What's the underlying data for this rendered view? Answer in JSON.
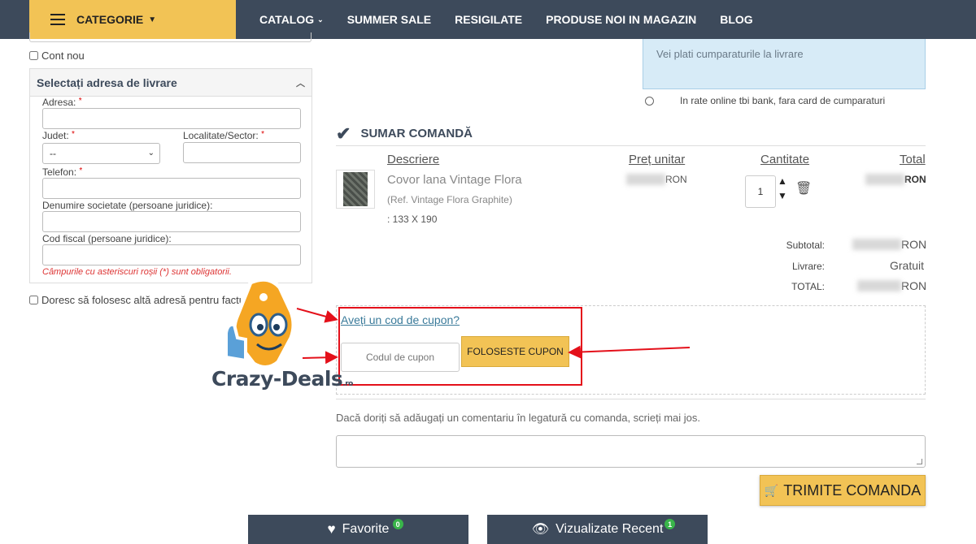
{
  "topnav": {
    "category_label": "CATEGORIE",
    "items": [
      "CATALOG",
      "SUMMER SALE",
      "RESIGILATE",
      "PRODUSE NOI IN MAGAZIN",
      "BLOG"
    ]
  },
  "left": {
    "new_account_label": "Cont nou",
    "address_panel": {
      "title": "Selectați adresa de livrare",
      "address_label": "Adresa:",
      "county_label": "Judet:",
      "county_value": "--",
      "city_label": "Localitate/Sector:",
      "phone_label": "Telefon:",
      "company_label": "Denumire societate (persoane juridice):",
      "fiscal_label": "Cod fiscal (persoane juridice):",
      "required_note": "Câmpurile cu asteriscuri roșii (*) sunt obligatorii.",
      "asterisk": "*"
    },
    "billing_checkbox_label": "Doresc să folosesc altă adresă pentru facturare"
  },
  "payment": {
    "cod_text": "Vei plati cumparaturile la livrare",
    "installments_text": "In rate online tbi bank, fara card de cumparaturi"
  },
  "summary": {
    "title": "SUMAR COMANDĂ",
    "headers": {
      "description": "Descriere",
      "unit_price": "Preț unitar",
      "quantity": "Cantitate",
      "total": "Total"
    },
    "product": {
      "name": "Covor lana Vintage Flora",
      "ref": "(Ref. Vintage Flora Graphite)",
      "size": ": 133 X 190",
      "currency": "RON",
      "quantity": "1"
    },
    "subtotal_label": "Subtotal:",
    "delivery_label": "Livrare:",
    "delivery_value": "Gratuit",
    "total_label": "TOTAL:",
    "currency": "RON"
  },
  "coupon": {
    "link_text": "Aveți un cod de cupon?",
    "input_placeholder": "Codul de cupon",
    "button_label": "FOLOSESTE CUPON"
  },
  "comment": {
    "label": "Dacă doriți să adăugați un comentariu în legatură cu comanda, scrieți mai jos."
  },
  "submit": {
    "label": "TRIMITE COMANDA"
  },
  "bottom": {
    "favorites_label": "Favorite",
    "favorites_count": "0",
    "recent_label": "Vizualizate Recent",
    "recent_count": "1"
  },
  "watermark": {
    "brand": "Crazy-Deals",
    "tld": ".ro"
  },
  "colors": {
    "nav_bg": "#3d4a5b",
    "accent_yellow": "#f2c355",
    "annotation_red": "#e4101a",
    "badge_green": "#39b54a",
    "info_blue": "#d7ebf7"
  }
}
